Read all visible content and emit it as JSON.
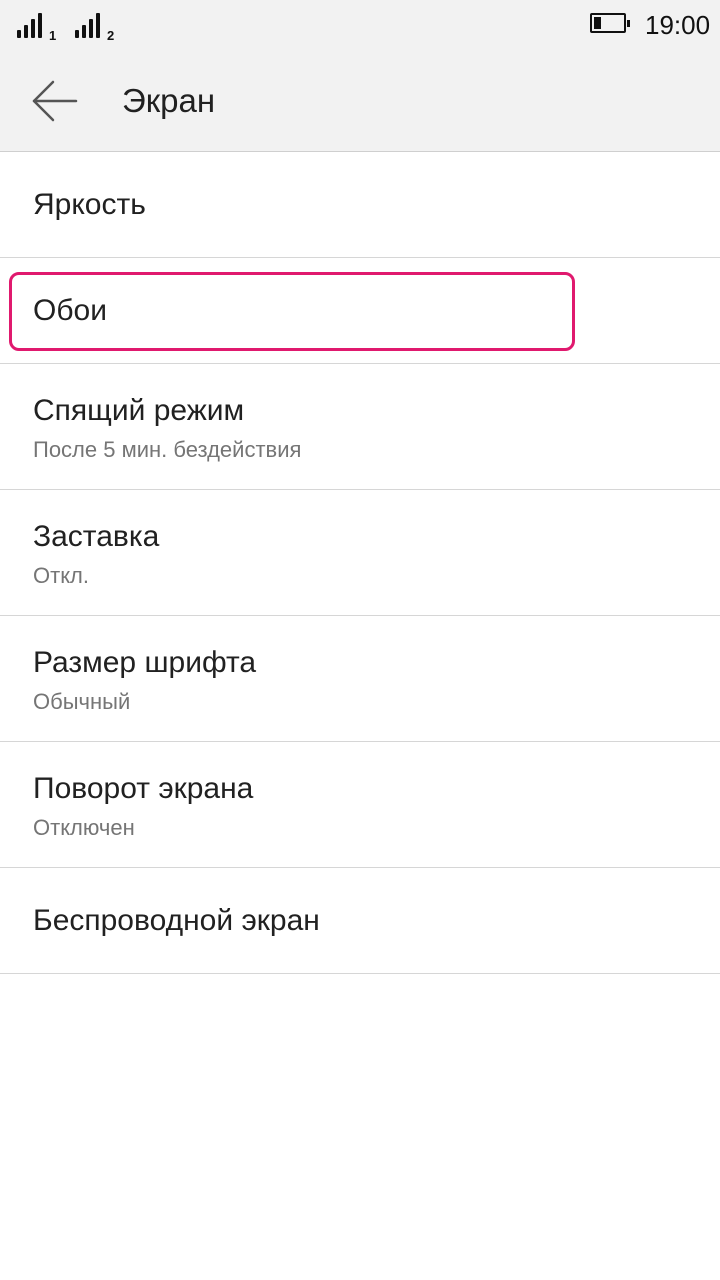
{
  "status_bar": {
    "sim1_label": "1",
    "sim2_label": "2",
    "time": "19:00",
    "battery_level": 0.25,
    "signal_icon": "signal-bars-icon",
    "battery_icon": "battery-icon"
  },
  "header": {
    "back_icon": "arrow-left-icon",
    "title": "Экран"
  },
  "settings": {
    "items": [
      {
        "title": "Яркость",
        "subtitle": ""
      },
      {
        "title": "Обои",
        "subtitle": "",
        "highlighted": true,
        "highlight_color": "#e0196e"
      },
      {
        "title": "Спящий режим",
        "subtitle": "После 5 мин. бездействия"
      },
      {
        "title": "Заставка",
        "subtitle": "Откл."
      },
      {
        "title": "Размер шрифта",
        "subtitle": "Обычный"
      },
      {
        "title": "Поворот экрана",
        "subtitle": "Отключен"
      },
      {
        "title": "Беспроводной экран",
        "subtitle": ""
      }
    ]
  },
  "colors": {
    "header_bg": "#f2f2f2",
    "divider": "#d6d6d6",
    "highlight": "#e0196e",
    "subtitle": "#757575"
  }
}
